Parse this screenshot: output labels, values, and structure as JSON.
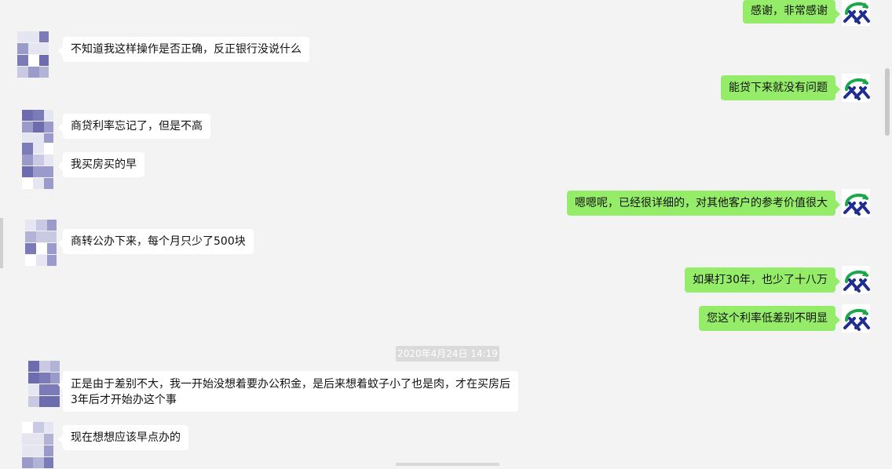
{
  "messages": [
    {
      "side": "out",
      "text": "感谢，非常感谢"
    },
    {
      "side": "in",
      "text": "不知道我这样操作是否正确，反正银行没说什么"
    },
    {
      "side": "out",
      "text": "能贷下来就没有问题"
    },
    {
      "side": "in",
      "text": "商贷利率忘记了，但是不高"
    },
    {
      "side": "in",
      "text": "我买房买的早"
    },
    {
      "side": "out",
      "text": "嗯嗯呢，已经很详细的，对其他客户的参考价值很大"
    },
    {
      "side": "in",
      "text": "商转公办下来，每个月只少了500块"
    },
    {
      "side": "out",
      "text": "如果打30年，也少了十八万"
    },
    {
      "side": "out",
      "text": "您这个利率低差别不明显"
    },
    {
      "side": "in",
      "text": "正是由于差别不大，我一开始没想着要办公积金，是后来想着蚊子小了也是肉，才在买房后3年后才开始办这个事"
    },
    {
      "side": "in",
      "text": "现在想想应该早点办的"
    }
  ],
  "timestamp": "2020年4月24日 14:19",
  "colors": {
    "background": "#f3f3f3",
    "outgoing_bubble": "#95ec69",
    "incoming_bubble": "#ffffff",
    "timestamp_bg": "#dadada",
    "avatar_self_green": "#1aa84a",
    "avatar_self_navy": "#1f2e8f",
    "avatar_mosaic_purple": "#7b7bb8"
  },
  "icons": {
    "self_avatar": "bank-logo-avatar-icon",
    "other_avatar": "pixelated-avatar-icon"
  }
}
